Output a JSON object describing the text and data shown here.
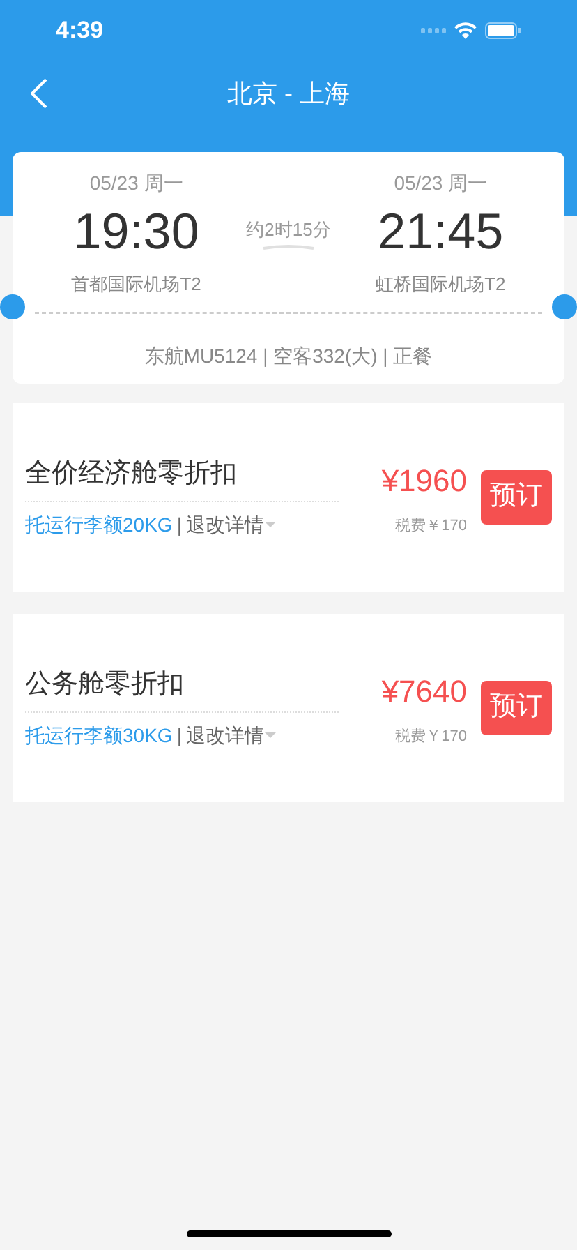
{
  "status_bar": {
    "time": "4:39"
  },
  "nav": {
    "title": "北京 - 上海"
  },
  "flight": {
    "depart": {
      "date": "05/23 周一",
      "time": "19:30",
      "airport": "首都国际机场T2"
    },
    "duration": "约2时15分",
    "arrive": {
      "date": "05/23 周一",
      "time": "21:45",
      "airport": "虹桥国际机场T2"
    },
    "info": "东航MU5124 | 空客332(大) | 正餐"
  },
  "fares": [
    {
      "name": "全价经济舱零折扣",
      "baggage": "托运行李额20KG",
      "separator": "|",
      "rules": "退改详情",
      "price": "¥1960",
      "tax": "税费￥170",
      "button": "预订"
    },
    {
      "name": "公务舱零折扣",
      "baggage": "托运行李额30KG",
      "separator": "|",
      "rules": "退改详情",
      "price": "¥7640",
      "tax": "税费￥170",
      "button": "预订"
    }
  ]
}
